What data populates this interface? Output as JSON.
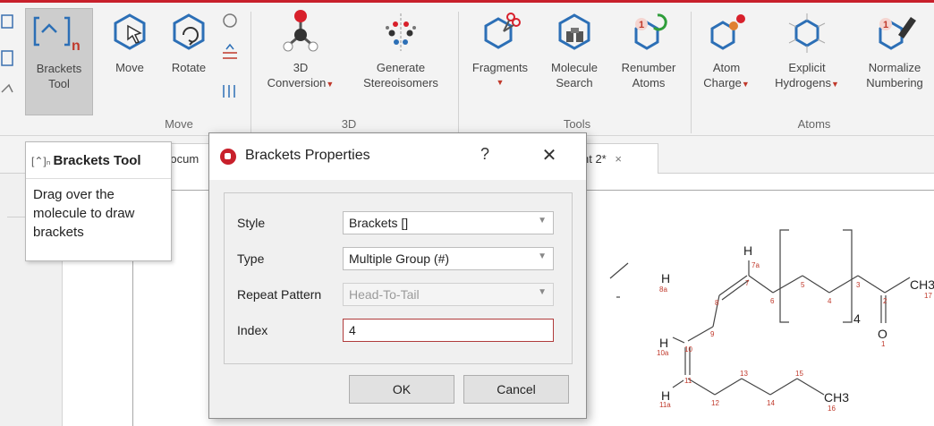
{
  "ribbon": {
    "brackets_label_1": "Brackets",
    "brackets_label_2": "Tool",
    "move_label": "Move",
    "rotate_label": "Rotate",
    "conv3d_label_1": "3D",
    "conv3d_label_2": "Conversion",
    "stereo_label_1": "Generate",
    "stereo_label_2": "Stereoisomers",
    "fragments_label": "Fragments",
    "molsearch_label_1": "Molecule",
    "molsearch_label_2": "Search",
    "renumber_label_1": "Renumber",
    "renumber_label_2": "Atoms",
    "atomcharge_label_1": "Atom",
    "atomcharge_label_2": "Charge",
    "explicit_label_1": "Explicit",
    "explicit_label_2": "Hydrogens",
    "normalize_label_1": "Normalize",
    "normalize_label_2": "Numbering",
    "groups": [
      "Move",
      "3D",
      "Tools",
      "Atoms"
    ]
  },
  "tabs": {
    "doc1": "Docum",
    "doc2": "nt 2*",
    "close": "×"
  },
  "tooltip": {
    "title": "Brackets Tool",
    "body": "Drag over the molecule to draw brackets"
  },
  "dialog": {
    "title": "Brackets Properties",
    "help": "?",
    "close": "✕",
    "style_label": "Style",
    "style_value": "Brackets []",
    "type_label": "Type",
    "type_value": "Multiple Group (#)",
    "repeat_label": "Repeat Pattern",
    "repeat_value": "Head-To-Tail",
    "index_label": "Index",
    "index_value": "4",
    "ok": "OK",
    "cancel": "Cancel"
  },
  "molecule": {
    "H_top": "H",
    "H_8a": "H",
    "H_10a": "H",
    "H_11a": "H",
    "CH3_17": "CH3",
    "CH3_16": "CH3",
    "O": "O",
    "repeat": "4",
    "n7a": "7a",
    "n8a": "8a",
    "n10a": "10a",
    "n11a": "11a",
    "n1": "1",
    "n2": "2",
    "n3": "3",
    "n4": "4",
    "n5": "5",
    "n6": "6",
    "n7": "7",
    "n8": "8",
    "n9": "9",
    "n10": "10",
    "n11": "11",
    "n12": "12",
    "n13": "13",
    "n14": "14",
    "n15": "15",
    "n16": "16",
    "n17": "17"
  },
  "colors": {
    "accent": "#c8202b",
    "atom_number": "#c0392b"
  }
}
